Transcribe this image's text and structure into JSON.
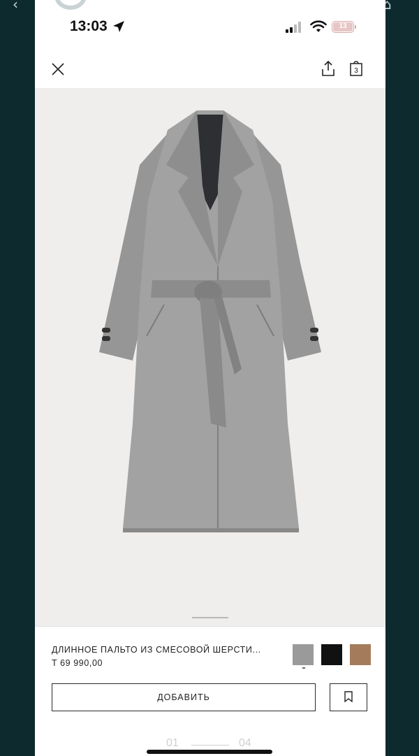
{
  "status_bar": {
    "time": "13:03",
    "battery": "13"
  },
  "nav": {
    "close_icon": "close-icon",
    "share_icon": "share-icon",
    "bag_icon": "bag-icon",
    "bag_count": "3"
  },
  "product": {
    "name": "ДЛИННОЕ ПАЛЬТО ИЗ СМЕСОВОЙ ШЕРСТИ...",
    "price": "T 69 990,00",
    "colors": [
      {
        "name": "grey",
        "hex": "#9a9a9a",
        "selected": true
      },
      {
        "name": "black",
        "hex": "#111111",
        "selected": false
      },
      {
        "name": "camel",
        "hex": "#a47c5b",
        "selected": false
      }
    ]
  },
  "actions": {
    "add_label": "ДОБАВИТЬ",
    "bookmark_icon": "bookmark-icon"
  },
  "pagination": {
    "current": "01",
    "total": "04"
  },
  "colors": {
    "frame_bg": "#0d2a2f",
    "image_bg": "#efeeec",
    "coat": "#9d9d9d"
  }
}
